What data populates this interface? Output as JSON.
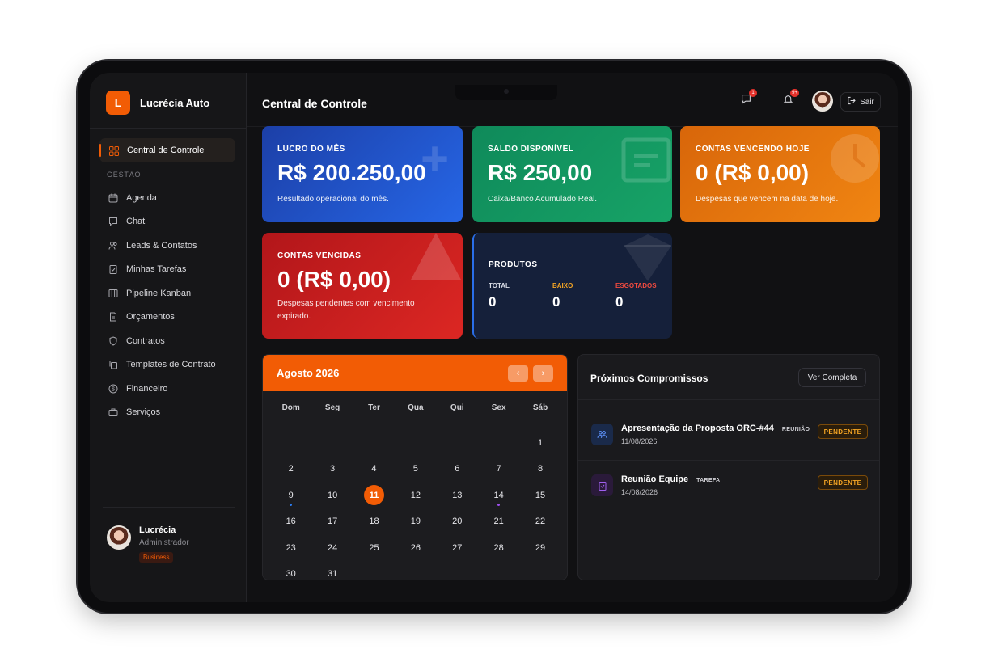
{
  "brand": {
    "initial": "L",
    "name": "Lucrécia Auto"
  },
  "nav": {
    "active": {
      "label": "Central de Controle",
      "icon": "grid-icon"
    },
    "section": "GESTÃO",
    "items": [
      {
        "label": "Agenda",
        "icon": "calendar-icon"
      },
      {
        "label": "Chat",
        "icon": "chat-icon"
      },
      {
        "label": "Leads & Contatos",
        "icon": "users-icon"
      },
      {
        "label": "Minhas Tarefas",
        "icon": "clipboard-icon"
      },
      {
        "label": "Pipeline Kanban",
        "icon": "kanban-icon"
      },
      {
        "label": "Orçamentos",
        "icon": "document-icon"
      },
      {
        "label": "Contratos",
        "icon": "shield-icon"
      },
      {
        "label": "Templates de Contrato",
        "icon": "copy-icon"
      },
      {
        "label": "Financeiro",
        "icon": "dollar-icon"
      },
      {
        "label": "Serviços",
        "icon": "briefcase-icon"
      }
    ]
  },
  "user": {
    "name": "Lucrécia",
    "role": "Administrador",
    "plan": "Business"
  },
  "header": {
    "title": "Central de Controle",
    "chat_badge": "1",
    "notif_badge": "9+",
    "logout_label": "Sair"
  },
  "cards": {
    "lucro": {
      "label": "LUCRO DO MÊS",
      "value": "R$ 200.250,00",
      "desc": "Resultado operacional do mês."
    },
    "saldo": {
      "label": "SALDO DISPONÍVEL",
      "value": "R$ 250,00",
      "desc": "Caixa/Banco Acumulado Real."
    },
    "hoje": {
      "label": "CONTAS VENCENDO HOJE",
      "value": "0 (R$ 0,00)",
      "desc": "Despesas que vencem na data de hoje."
    },
    "vencidas": {
      "label": "CONTAS VENCIDAS",
      "value": "0 (R$ 0,00)",
      "desc": "Despesas pendentes com vencimento expirado."
    },
    "produtos": {
      "label": "PRODUTOS",
      "total_label": "TOTAL",
      "total": "0",
      "baixo_label": "BAIXO",
      "baixo": "0",
      "esgotados_label": "ESGOTADOS",
      "esgotados": "0"
    }
  },
  "calendar": {
    "title": "Agosto 2026",
    "weekdays": [
      "Dom",
      "Seg",
      "Ter",
      "Qua",
      "Qui",
      "Sex",
      "Sáb"
    ],
    "first_weekday": 6,
    "days_in_month": 31,
    "today": 11,
    "event_days": [
      {
        "day": 9,
        "color": "#2a7bf0"
      },
      {
        "day": 14,
        "color": "#a050f0"
      }
    ]
  },
  "appointments": {
    "title": "Próximos Compromissos",
    "view_all": "Ver Completa",
    "items": [
      {
        "title": "Apresentação da Proposta ORC-#44",
        "type": "REUNIÃO",
        "date": "11/08/2026",
        "status": "PENDENTE",
        "icon": "people-icon"
      },
      {
        "title": "Reunião Equipe",
        "type": "TAREFA",
        "date": "14/08/2026",
        "status": "PENDENTE",
        "icon": "clipboard-icon"
      }
    ]
  },
  "colors": {
    "accent": "#f25c05",
    "blue": "#2666e6",
    "green": "#17a367",
    "orange": "#f08512",
    "red": "#dc2723",
    "pending": "#f5a524"
  }
}
